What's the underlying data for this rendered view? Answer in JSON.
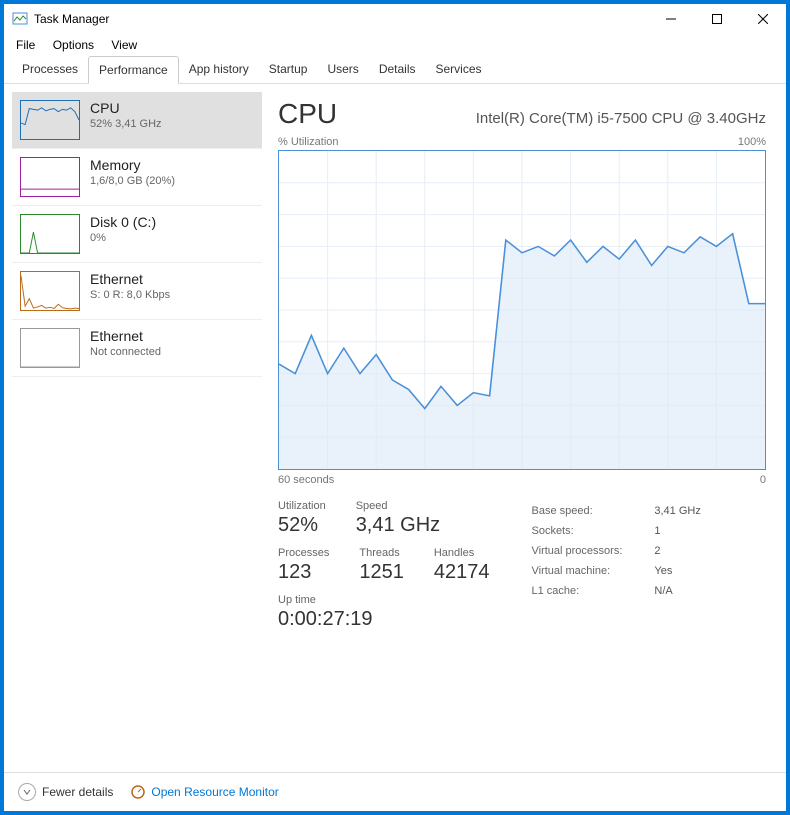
{
  "window": {
    "title": "Task Manager",
    "menu": {
      "file": "File",
      "options": "Options",
      "view": "View"
    }
  },
  "tabs": [
    "Processes",
    "Performance",
    "App history",
    "Startup",
    "Users",
    "Details",
    "Services"
  ],
  "active_tab": 1,
  "sidebar": {
    "items": [
      {
        "title": "CPU",
        "sub": "52%  3,41 GHz",
        "color": "#1a6fb8"
      },
      {
        "title": "Memory",
        "sub": "1,6/8,0 GB (20%)",
        "color": "#a020a0"
      },
      {
        "title": "Disk 0 (C:)",
        "sub": "0%",
        "color": "#2a8a2a"
      },
      {
        "title": "Ethernet",
        "sub": "S: 0  R: 8,0 Kbps",
        "color": "#b86a1a"
      },
      {
        "title": "Ethernet",
        "sub": "Not connected",
        "color": "#999999"
      }
    ]
  },
  "main": {
    "title": "CPU",
    "model": "Intel(R) Core(TM) i5-7500 CPU @ 3.40GHz",
    "chart_top_left": "% Utilization",
    "chart_top_right": "100%",
    "chart_bottom_left": "60 seconds",
    "chart_bottom_right": "0",
    "stats": {
      "utilization_label": "Utilization",
      "utilization": "52%",
      "speed_label": "Speed",
      "speed": "3,41 GHz",
      "processes_label": "Processes",
      "processes": "123",
      "threads_label": "Threads",
      "threads": "1251",
      "handles_label": "Handles",
      "handles": "42174",
      "uptime_label": "Up time",
      "uptime": "0:00:27:19"
    },
    "info": {
      "base_speed_label": "Base speed:",
      "base_speed": "3,41 GHz",
      "sockets_label": "Sockets:",
      "sockets": "1",
      "virtual_processors_label": "Virtual processors:",
      "virtual_processors": "2",
      "virtual_machine_label": "Virtual machine:",
      "virtual_machine": "Yes",
      "l1_label": "L1 cache:",
      "l1": "N/A"
    }
  },
  "footer": {
    "fewer": "Fewer details",
    "resource_link": "Open Resource Monitor"
  },
  "chart_data": {
    "type": "line",
    "title": "CPU % Utilization",
    "xlabel": "seconds ago",
    "ylabel": "% Utilization",
    "ylim": [
      0,
      100
    ],
    "xlim": [
      60,
      0
    ],
    "x": [
      60,
      58,
      56,
      54,
      52,
      50,
      48,
      46,
      44,
      42,
      40,
      38,
      36,
      34,
      32,
      30,
      28,
      26,
      24,
      22,
      20,
      18,
      16,
      14,
      12,
      10,
      8,
      6,
      4,
      2,
      0
    ],
    "values": [
      33,
      30,
      42,
      30,
      38,
      30,
      36,
      28,
      25,
      19,
      26,
      20,
      24,
      23,
      72,
      68,
      70,
      67,
      72,
      65,
      70,
      66,
      72,
      64,
      70,
      68,
      73,
      70,
      74,
      52,
      52
    ]
  },
  "sidebar_thumbs": {
    "cpu": [
      42,
      38,
      80,
      78,
      76,
      82,
      74,
      78,
      80,
      72,
      78,
      76,
      82,
      72,
      50
    ],
    "memory": [
      18,
      18,
      18,
      18,
      18,
      18,
      18,
      18,
      18,
      18,
      18,
      18,
      18,
      18,
      18
    ],
    "disk": [
      0,
      0,
      0,
      55,
      0,
      0,
      0,
      0,
      0,
      0,
      0,
      0,
      0,
      0,
      0
    ],
    "ethernet1": [
      90,
      10,
      30,
      5,
      8,
      12,
      5,
      7,
      4,
      15,
      6,
      4,
      3,
      5,
      4
    ],
    "ethernet2": [
      0,
      0,
      0,
      0,
      0,
      0,
      0,
      0,
      0,
      0,
      0,
      0,
      0,
      0,
      0
    ]
  }
}
